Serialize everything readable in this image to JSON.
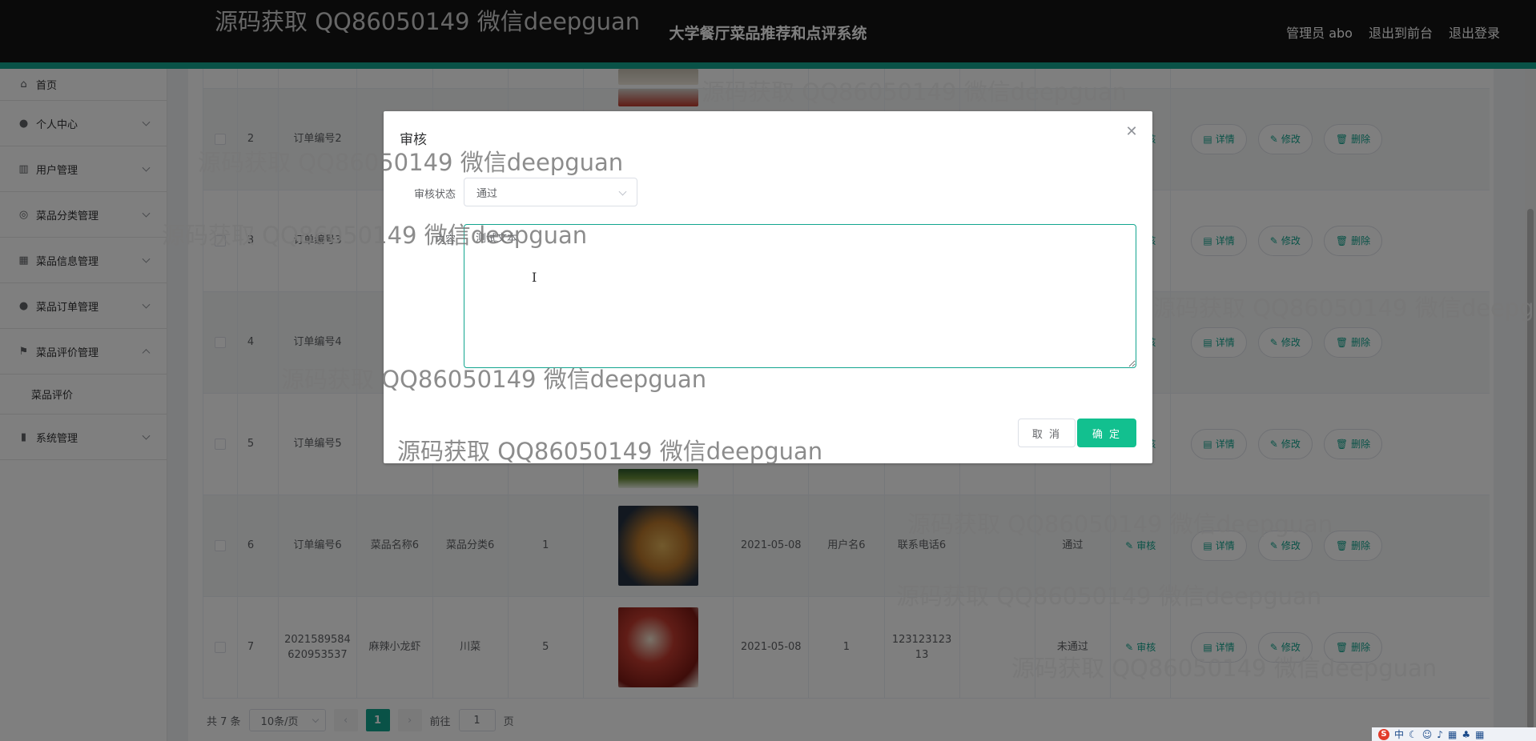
{
  "header": {
    "title": "大学餐厅菜品推荐和点评系统",
    "links": [
      "管理员 abo",
      "退出到前台",
      "退出登录"
    ]
  },
  "sidebar": {
    "items": [
      {
        "label": "首页",
        "icon": "home-icon"
      },
      {
        "label": "个人中心",
        "icon": "user-icon"
      },
      {
        "label": "用户管理",
        "icon": "table-icon"
      },
      {
        "label": "菜品分类管理",
        "icon": "compass-icon"
      },
      {
        "label": "菜品信息管理",
        "icon": "grid-icon"
      },
      {
        "label": "菜品订单管理",
        "icon": "user-icon"
      },
      {
        "label": "菜品评价管理",
        "icon": "flag-icon"
      },
      {
        "label": "系统管理",
        "icon": "chart-icon"
      }
    ],
    "submenu": "菜品评价"
  },
  "table": {
    "rows": [
      {
        "index": "2",
        "order": "订单编号2",
        "name": "",
        "category": "",
        "qty": "",
        "date": "",
        "user": "",
        "phone": "",
        "status": ""
      },
      {
        "index": "3",
        "order": "订单编号3",
        "name": "",
        "category": "",
        "qty": "",
        "date": "",
        "user": "",
        "phone": "",
        "status": ""
      },
      {
        "index": "4",
        "order": "订单编号4",
        "name": "",
        "category": "",
        "qty": "",
        "date": "",
        "user": "",
        "phone": "",
        "status": ""
      },
      {
        "index": "5",
        "order": "订单编号5",
        "name": "",
        "category": "",
        "qty": "",
        "date": "",
        "user": "",
        "phone": "",
        "status": ""
      },
      {
        "index": "6",
        "order": "订单编号6",
        "name": "菜品名称6",
        "category": "菜品分类6",
        "qty": "1",
        "date": "2021-05-08",
        "user": "用户名6",
        "phone": "联系电话6",
        "status": "通过"
      },
      {
        "index": "7",
        "order": "2021589584620953537",
        "name": "麻辣小龙虾",
        "category": "川菜",
        "qty": "5",
        "date": "2021-05-08",
        "user": "1",
        "phone": "12312312313",
        "status": "未通过"
      }
    ],
    "action_audit": "审核",
    "action_detail": "详情",
    "action_edit": "修改",
    "action_delete": "删除"
  },
  "pager": {
    "total": "共 7 条",
    "page_size": "10条/页",
    "current": "1",
    "goto_label": "前往",
    "goto_value": "1",
    "page_unit": "页"
  },
  "dialog": {
    "title": "审核",
    "status_label": "审核状态",
    "status_value": "通过",
    "content_label": "内容",
    "content_value": "测试文本",
    "cancel": "取 消",
    "confirm": "确 定"
  },
  "watermark": "源码获取 QQ86050149 微信deepguan",
  "watermark_cut": "源码获取 QQ86050149 微信deepg",
  "colors": {
    "accent": "#12a58f",
    "confirm": "#12c08f",
    "header_bg": "#151515"
  }
}
